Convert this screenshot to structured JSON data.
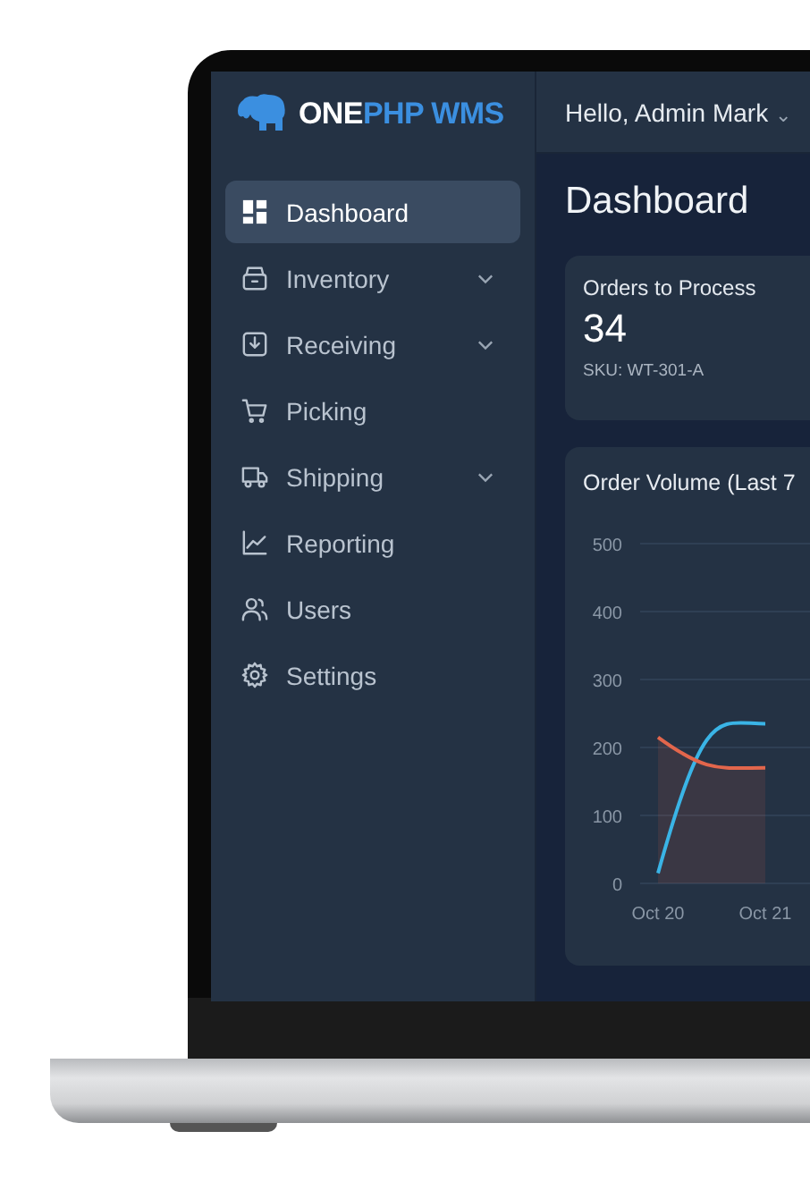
{
  "brand": {
    "main": "ONE",
    "accent": "PHP WMS"
  },
  "user_menu": {
    "label": "Hello, Admin Mark",
    "caret": "⌄"
  },
  "sidebar": {
    "items": [
      {
        "label": "Dashboard",
        "selected": true,
        "has_submenu": false
      },
      {
        "label": "Inventory",
        "selected": false,
        "has_submenu": true
      },
      {
        "label": "Receiving",
        "selected": false,
        "has_submenu": true
      },
      {
        "label": "Picking",
        "selected": false,
        "has_submenu": false
      },
      {
        "label": "Shipping",
        "selected": false,
        "has_submenu": true
      },
      {
        "label": "Reporting",
        "selected": false,
        "has_submenu": false
      },
      {
        "label": "Users",
        "selected": false,
        "has_submenu": false
      },
      {
        "label": "Settings",
        "selected": false,
        "has_submenu": false
      }
    ]
  },
  "page_title": "Dashboard",
  "stat_card": {
    "title": "Orders to Process",
    "value": "34",
    "note": "SKU: WT-301-A"
  },
  "chart_card": {
    "chart_data": {
      "type": "line",
      "title": "Order Volume (Last 7",
      "categories": [
        "Oct 20",
        "Oct 21"
      ],
      "series": [
        {
          "type": "line",
          "color": "#3ab4e6",
          "values": [
            15,
            235
          ]
        },
        {
          "type": "area",
          "color": "#e2664c",
          "values": [
            215,
            170
          ]
        }
      ],
      "grid": true,
      "ylim": [
        0,
        500
      ],
      "yticks": [
        0,
        100,
        200,
        300,
        400,
        500
      ]
    }
  }
}
